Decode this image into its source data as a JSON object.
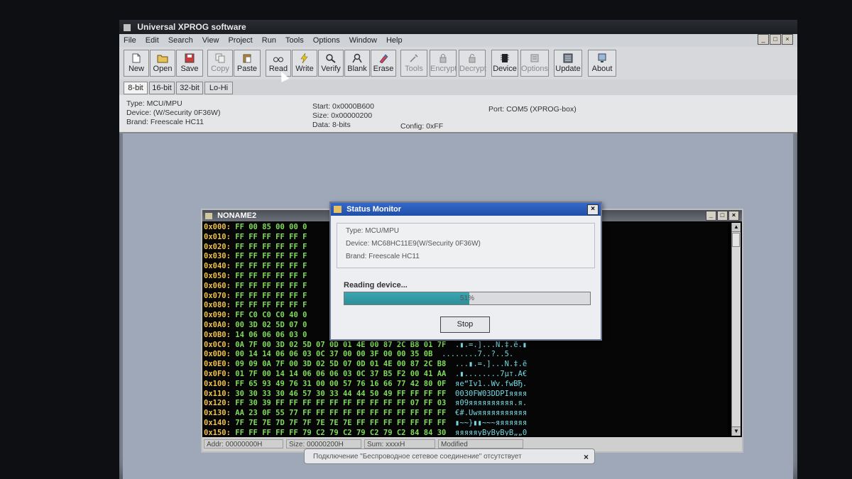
{
  "app": {
    "title": "Universal XPROG software",
    "menu": [
      "File",
      "Edit",
      "Search",
      "View",
      "Project",
      "Run",
      "Tools",
      "Options",
      "Window",
      "Help"
    ],
    "window_controls": [
      "_",
      "□",
      "×"
    ]
  },
  "toolbar": {
    "buttons": [
      {
        "label": "New",
        "icon": "new-file-icon",
        "enabled": true
      },
      {
        "label": "Open",
        "icon": "open-file-icon",
        "enabled": true
      },
      {
        "label": "Save",
        "icon": "save-icon",
        "enabled": true
      },
      {
        "label": "Copy",
        "icon": "copy-icon",
        "enabled": false
      },
      {
        "label": "Paste",
        "icon": "paste-icon",
        "enabled": true
      },
      {
        "label": "Read",
        "icon": "read-glasses-icon",
        "enabled": true
      },
      {
        "label": "Write",
        "icon": "write-lightning-icon",
        "enabled": true
      },
      {
        "label": "Verify",
        "icon": "verify-magnifier-icon",
        "enabled": true
      },
      {
        "label": "Blank",
        "icon": "blank-check-icon",
        "enabled": true
      },
      {
        "label": "Erase",
        "icon": "erase-icon",
        "enabled": true
      },
      {
        "label": "Tools",
        "icon": "tools-icon",
        "enabled": false
      },
      {
        "label": "Encrypt",
        "icon": "lock-icon",
        "enabled": false
      },
      {
        "label": "Decrypt",
        "icon": "unlock-icon",
        "enabled": false
      },
      {
        "label": "Device",
        "icon": "chip-icon",
        "enabled": true
      },
      {
        "label": "Options",
        "icon": "options-icon",
        "enabled": false
      },
      {
        "label": "Update",
        "icon": "update-icon",
        "enabled": true
      },
      {
        "label": "About",
        "icon": "about-icon",
        "enabled": true
      }
    ]
  },
  "bitmodes": {
    "items": [
      "8-bit",
      "16-bit",
      "32-bit",
      "Lo-Hi"
    ],
    "active": "8-bit"
  },
  "info": {
    "type": "Type: MCU/MPU",
    "device": "Device: (W/Security 0F36W)",
    "brand": "Brand: Freescale HC11",
    "start": "Start: 0x0000B600",
    "size": "Size: 0x00000200",
    "data": "Data: 8-bits",
    "config": "Config: 0xFF",
    "port": "Port: COM5 (XPROG-box)"
  },
  "editor": {
    "title": "NONAME2",
    "controls": [
      "_",
      "□",
      "×"
    ],
    "rows": [
      {
        "addr": "0x000:",
        "hex": "FF 00 85 00 00 0",
        "ascii": ""
      },
      {
        "addr": "0x010:",
        "hex": "FF FF FF FF FF F",
        "ascii": ""
      },
      {
        "addr": "0x020:",
        "hex": "FF FF FF FF FF F",
        "ascii": ""
      },
      {
        "addr": "0x030:",
        "hex": "FF FF FF FF FF F",
        "ascii": ""
      },
      {
        "addr": "0x040:",
        "hex": "FF FF FF FF FF F",
        "ascii": ""
      },
      {
        "addr": "0x050:",
        "hex": "FF FF FF FF FF F",
        "ascii": ""
      },
      {
        "addr": "0x060:",
        "hex": "FF FF FF FF FF F",
        "ascii": ""
      },
      {
        "addr": "0x070:",
        "hex": "FF FF FF FF FF F",
        "ascii": ""
      },
      {
        "addr": "0x080:",
        "hex": "FF FF FF FF FF F",
        "ascii": ""
      },
      {
        "addr": "0x090:",
        "hex": "FF C0 C0 C0 40 0",
        "ascii": ""
      },
      {
        "addr": "0x0A0:",
        "hex": "00 3D 02 5D 07 0",
        "ascii": ""
      },
      {
        "addr": "0x0B0:",
        "hex": "14 06 06 06 03 0",
        "ascii": ""
      },
      {
        "addr": "0x0C0:",
        "hex": "0A 7F 00 3D 02 5D 07 0D 01 4E 00 87 2C B8 01 7F",
        "ascii": ".▮.=.]...N.‡.ё.▮"
      },
      {
        "addr": "0x0D0:",
        "hex": "00 14 14 06 06 03 0C 37 00 00 3F 00 00 35 0B",
        "ascii": "........7..?..5."
      },
      {
        "addr": "0x0E0:",
        "hex": "09 09 0A 7F 00 3D 02 5D 07 0D 01 4E 00 87 2C B8",
        "ascii": "...▮.=.]...N.‡.ё"
      },
      {
        "addr": "0x0F0:",
        "hex": "01 7F 00 14 14 06 06 06 03 0C 37 B5 F2 00 41 AA",
        "ascii": ".▮........7µт.A€"
      },
      {
        "addr": "0x100:",
        "hex": "FF 65 93 49 76 31 00 00 57 76 16 66 77 42 80 0F",
        "ascii": "яe“Iv1..Wv.fwBЂ."
      },
      {
        "addr": "0x110:",
        "hex": "30 30 33 30 46 57 30 33 44 44 50 49 FF FF FF FF",
        "ascii": "0030FW03DDPIяяяя"
      },
      {
        "addr": "0x120:",
        "hex": "FF 30 39 FF FF FF FF FF FF FF FF FF FF 07 FF 03",
        "ascii": "я09яяяяяяяяяя.я."
      },
      {
        "addr": "0x130:",
        "hex": "AA 23 0F 55 77 FF FF FF FF FF FF FF FF FF FF FF",
        "ascii": "€#.Uwяяяяяяяяяяя"
      },
      {
        "addr": "0x140:",
        "hex": "7F 7E 7E 7D 7F 7F 7E 7E 7E FF FF FF FF FF FF FF",
        "ascii": "▮~~}▮▮~~~яяяяяяя"
      },
      {
        "addr": "0x150:",
        "hex": "FF FF FF FF FF 79 C2 79 C2 79 C2 79 C2 84 84 30",
        "ascii": "яяяяяyВyВyВyВ„„0"
      }
    ],
    "status": {
      "addr": "Addr: 00000000H",
      "size": "Size: 00000200H",
      "sum": "Sum: xxxxH",
      "modified": "Modified"
    }
  },
  "dialog": {
    "title": "Status Monitor",
    "close": "×",
    "type": "Type: MCU/MPU",
    "device": "Device: MC68HC11E9(W/Security 0F36W)",
    "brand": "Brand: Freescale HC11",
    "reading": "Reading device...",
    "progress_percent": 51,
    "progress_label": "51%",
    "stop_label": "Stop"
  },
  "toast": {
    "text": "Подключение \"Беспроводное сетевое соединение\" отсутствует",
    "close": "×"
  }
}
